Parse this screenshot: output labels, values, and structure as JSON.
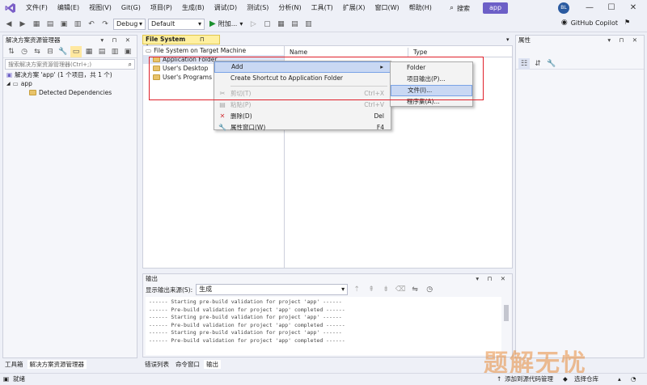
{
  "menu": {
    "items": [
      "文件(F)",
      "编辑(E)",
      "视图(V)",
      "Git(G)",
      "项目(P)",
      "生成(B)",
      "调试(D)",
      "测试(S)",
      "分析(N)",
      "工具(T)",
      "扩展(X)",
      "窗口(W)",
      "帮助(H)"
    ],
    "search_label": "搜索",
    "solution_name": "app",
    "avatar_initials": "BL"
  },
  "toolbar": {
    "config": "Debug",
    "platform": "Default",
    "run_label": "附加...",
    "copilot_label": "GitHub Copilot"
  },
  "solution_explorer": {
    "title": "解决方案资源管理器",
    "search_placeholder": "搜索解决方案资源管理器(Ctrl+;)",
    "solution_row": "解决方案 'app' (1 个项目，共 1 个)",
    "project": "app",
    "dependencies": "Detected Dependencies"
  },
  "filesystem": {
    "tab": "File System (app)",
    "root": "File System on Target Machine",
    "folders": [
      "Application Folder",
      "User's Desktop",
      "User's Programs Menu"
    ],
    "col_name": "Name",
    "col_type": "Type"
  },
  "context_menu": {
    "add": "Add",
    "shortcut": "Create Shortcut to Application Folder",
    "cut": "剪切(T)",
    "cut_key": "Ctrl+X",
    "paste": "粘贴(P)",
    "paste_key": "Ctrl+V",
    "delete": "删除(D)",
    "delete_key": "Del",
    "properties": "属性窗口(W)",
    "properties_key": "F4"
  },
  "submenu": {
    "items": [
      "Folder",
      "项目输出(P)...",
      "文件(I)...",
      "程序集(A)..."
    ]
  },
  "properties": {
    "title": "属性"
  },
  "output": {
    "title": "输出",
    "source_label": "显示输出来源(S):",
    "source_value": "生成",
    "lines": [
      "------ Starting pre-build validation for project 'app' ------",
      "------ Pre-build validation for project 'app' completed ------",
      "------ Starting pre-build validation for project 'app' ------",
      "------ Pre-build validation for project 'app' completed ------",
      "------ Starting pre-build validation for project 'app' ------",
      "------ Pre-build validation for project 'app' completed ------"
    ]
  },
  "bottom_tabs": {
    "left": [
      "工具箱",
      "解决方案资源管理器"
    ],
    "center": [
      "错误列表",
      "命令窗口",
      "输出"
    ]
  },
  "status": {
    "ready": "就绪",
    "add_source": "添加到源代码管理",
    "select_repo": "选择仓库"
  },
  "watermark": "题解无忧",
  "colors": {
    "accent": "#6c5fc7",
    "highlight": "#c9d8f3",
    "annotation": "#e0202a"
  }
}
